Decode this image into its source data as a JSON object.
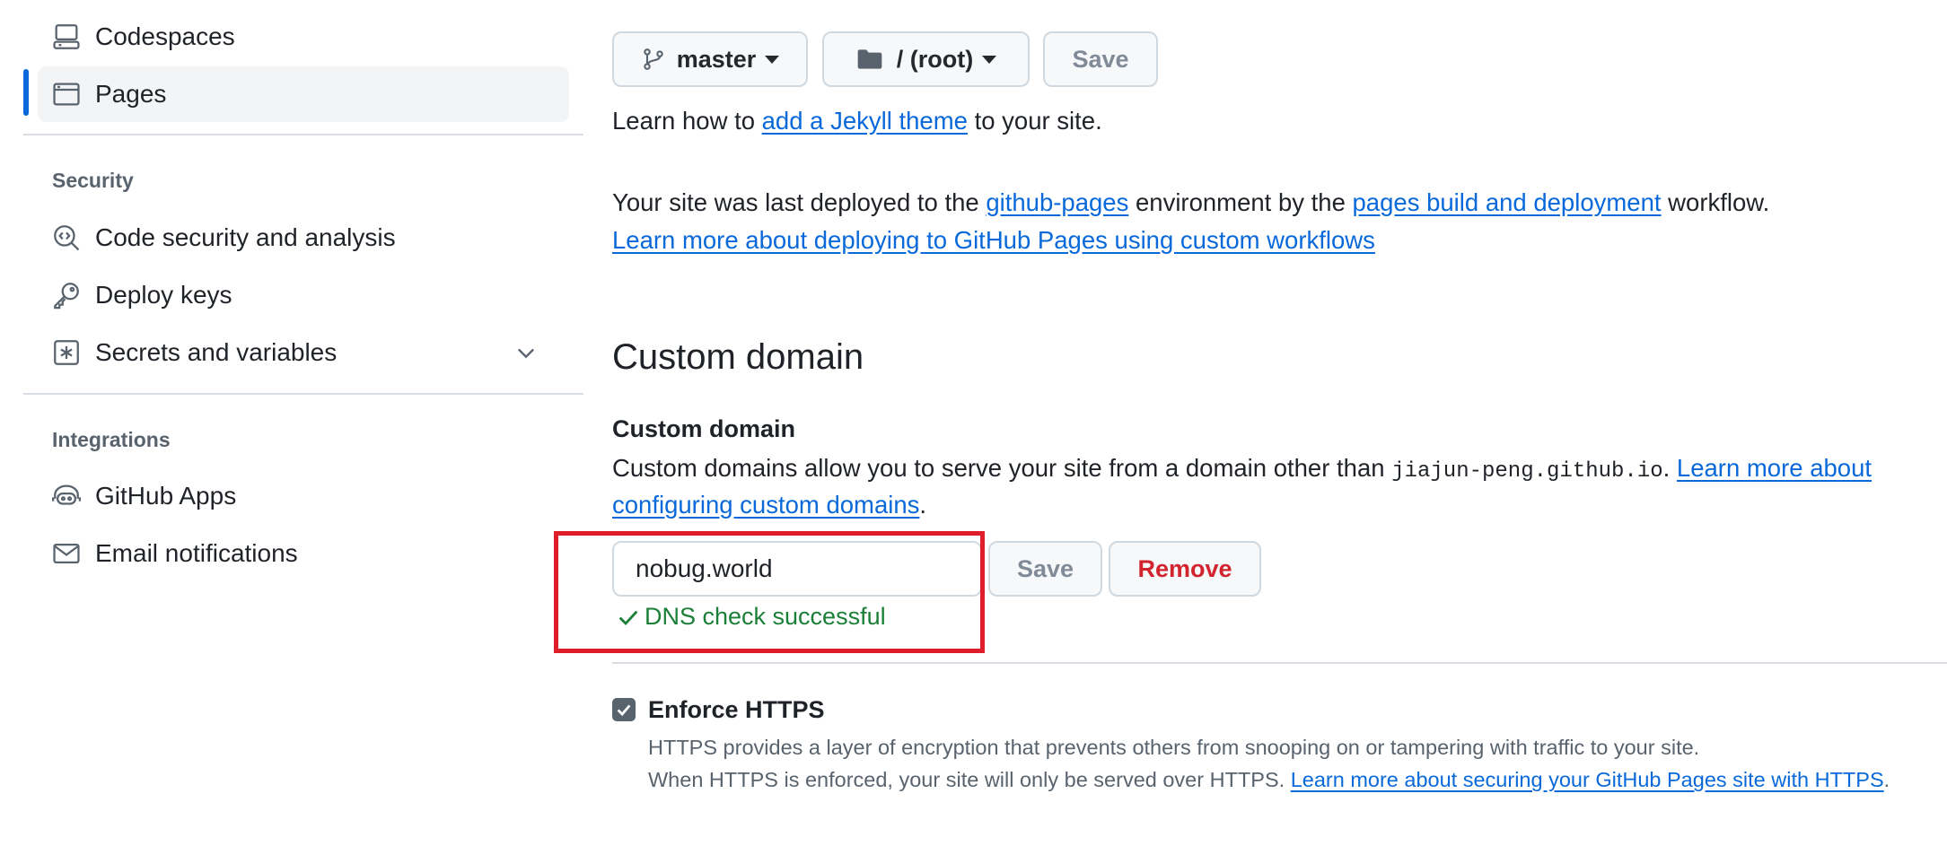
{
  "sidebar": {
    "items_top": [
      {
        "label": "Codespaces",
        "icon": "codespaces-icon"
      },
      {
        "label": "Pages",
        "icon": "browser-icon",
        "active": true
      }
    ],
    "security_heading": "Security",
    "security_items": [
      {
        "label": "Code security and analysis",
        "icon": "codescan-icon"
      },
      {
        "label": "Deploy keys",
        "icon": "key-icon"
      },
      {
        "label": "Secrets and variables",
        "icon": "key-asterisk-icon"
      }
    ],
    "integrations_heading": "Integrations",
    "integration_items": [
      {
        "label": "GitHub Apps",
        "icon": "hubot-icon"
      },
      {
        "label": "Email notifications",
        "icon": "mail-icon"
      }
    ]
  },
  "source": {
    "branch_label": "master",
    "folder_label": "/ (root)",
    "save_label": "Save",
    "jekyll_prefix": "Learn how to ",
    "jekyll_link": "add a Jekyll theme",
    "jekyll_suffix": " to your site."
  },
  "deploy": {
    "prefix": "Your site was last deployed to the ",
    "env_link": "github-pages",
    "middle": " environment by the ",
    "workflow_link": "pages build and deployment",
    "suffix": " workflow.",
    "learn_link": "Learn more about deploying to GitHub Pages using custom workflows"
  },
  "custom_domain": {
    "heading": "Custom domain",
    "label": "Custom domain",
    "desc_prefix": "Custom domains allow you to serve your site from a domain other than ",
    "desc_domain": "jiajun-peng.github.io",
    "desc_dot": ". ",
    "learn_link_1": "Learn more about",
    "learn_link_2": "configuring custom domains",
    "desc_end": ".",
    "input_value": "nobug.world",
    "save_label": "Save",
    "remove_label": "Remove",
    "dns_status": "DNS check successful"
  },
  "https": {
    "label": "Enforce HTTPS",
    "checked": true,
    "desc_1": "HTTPS provides a layer of encryption that prevents others from snooping on or tampering with traffic to your site.",
    "desc_2_prefix": "When HTTPS is enforced, your site will only be served over HTTPS. ",
    "desc_2_link": "Learn more about securing your GitHub Pages site with HTTPS",
    "desc_2_suffix": "."
  },
  "colors": {
    "accent": "#0969da",
    "success": "#1a7f37",
    "danger": "#d1242f",
    "highlight_box": "#e01e2b"
  }
}
